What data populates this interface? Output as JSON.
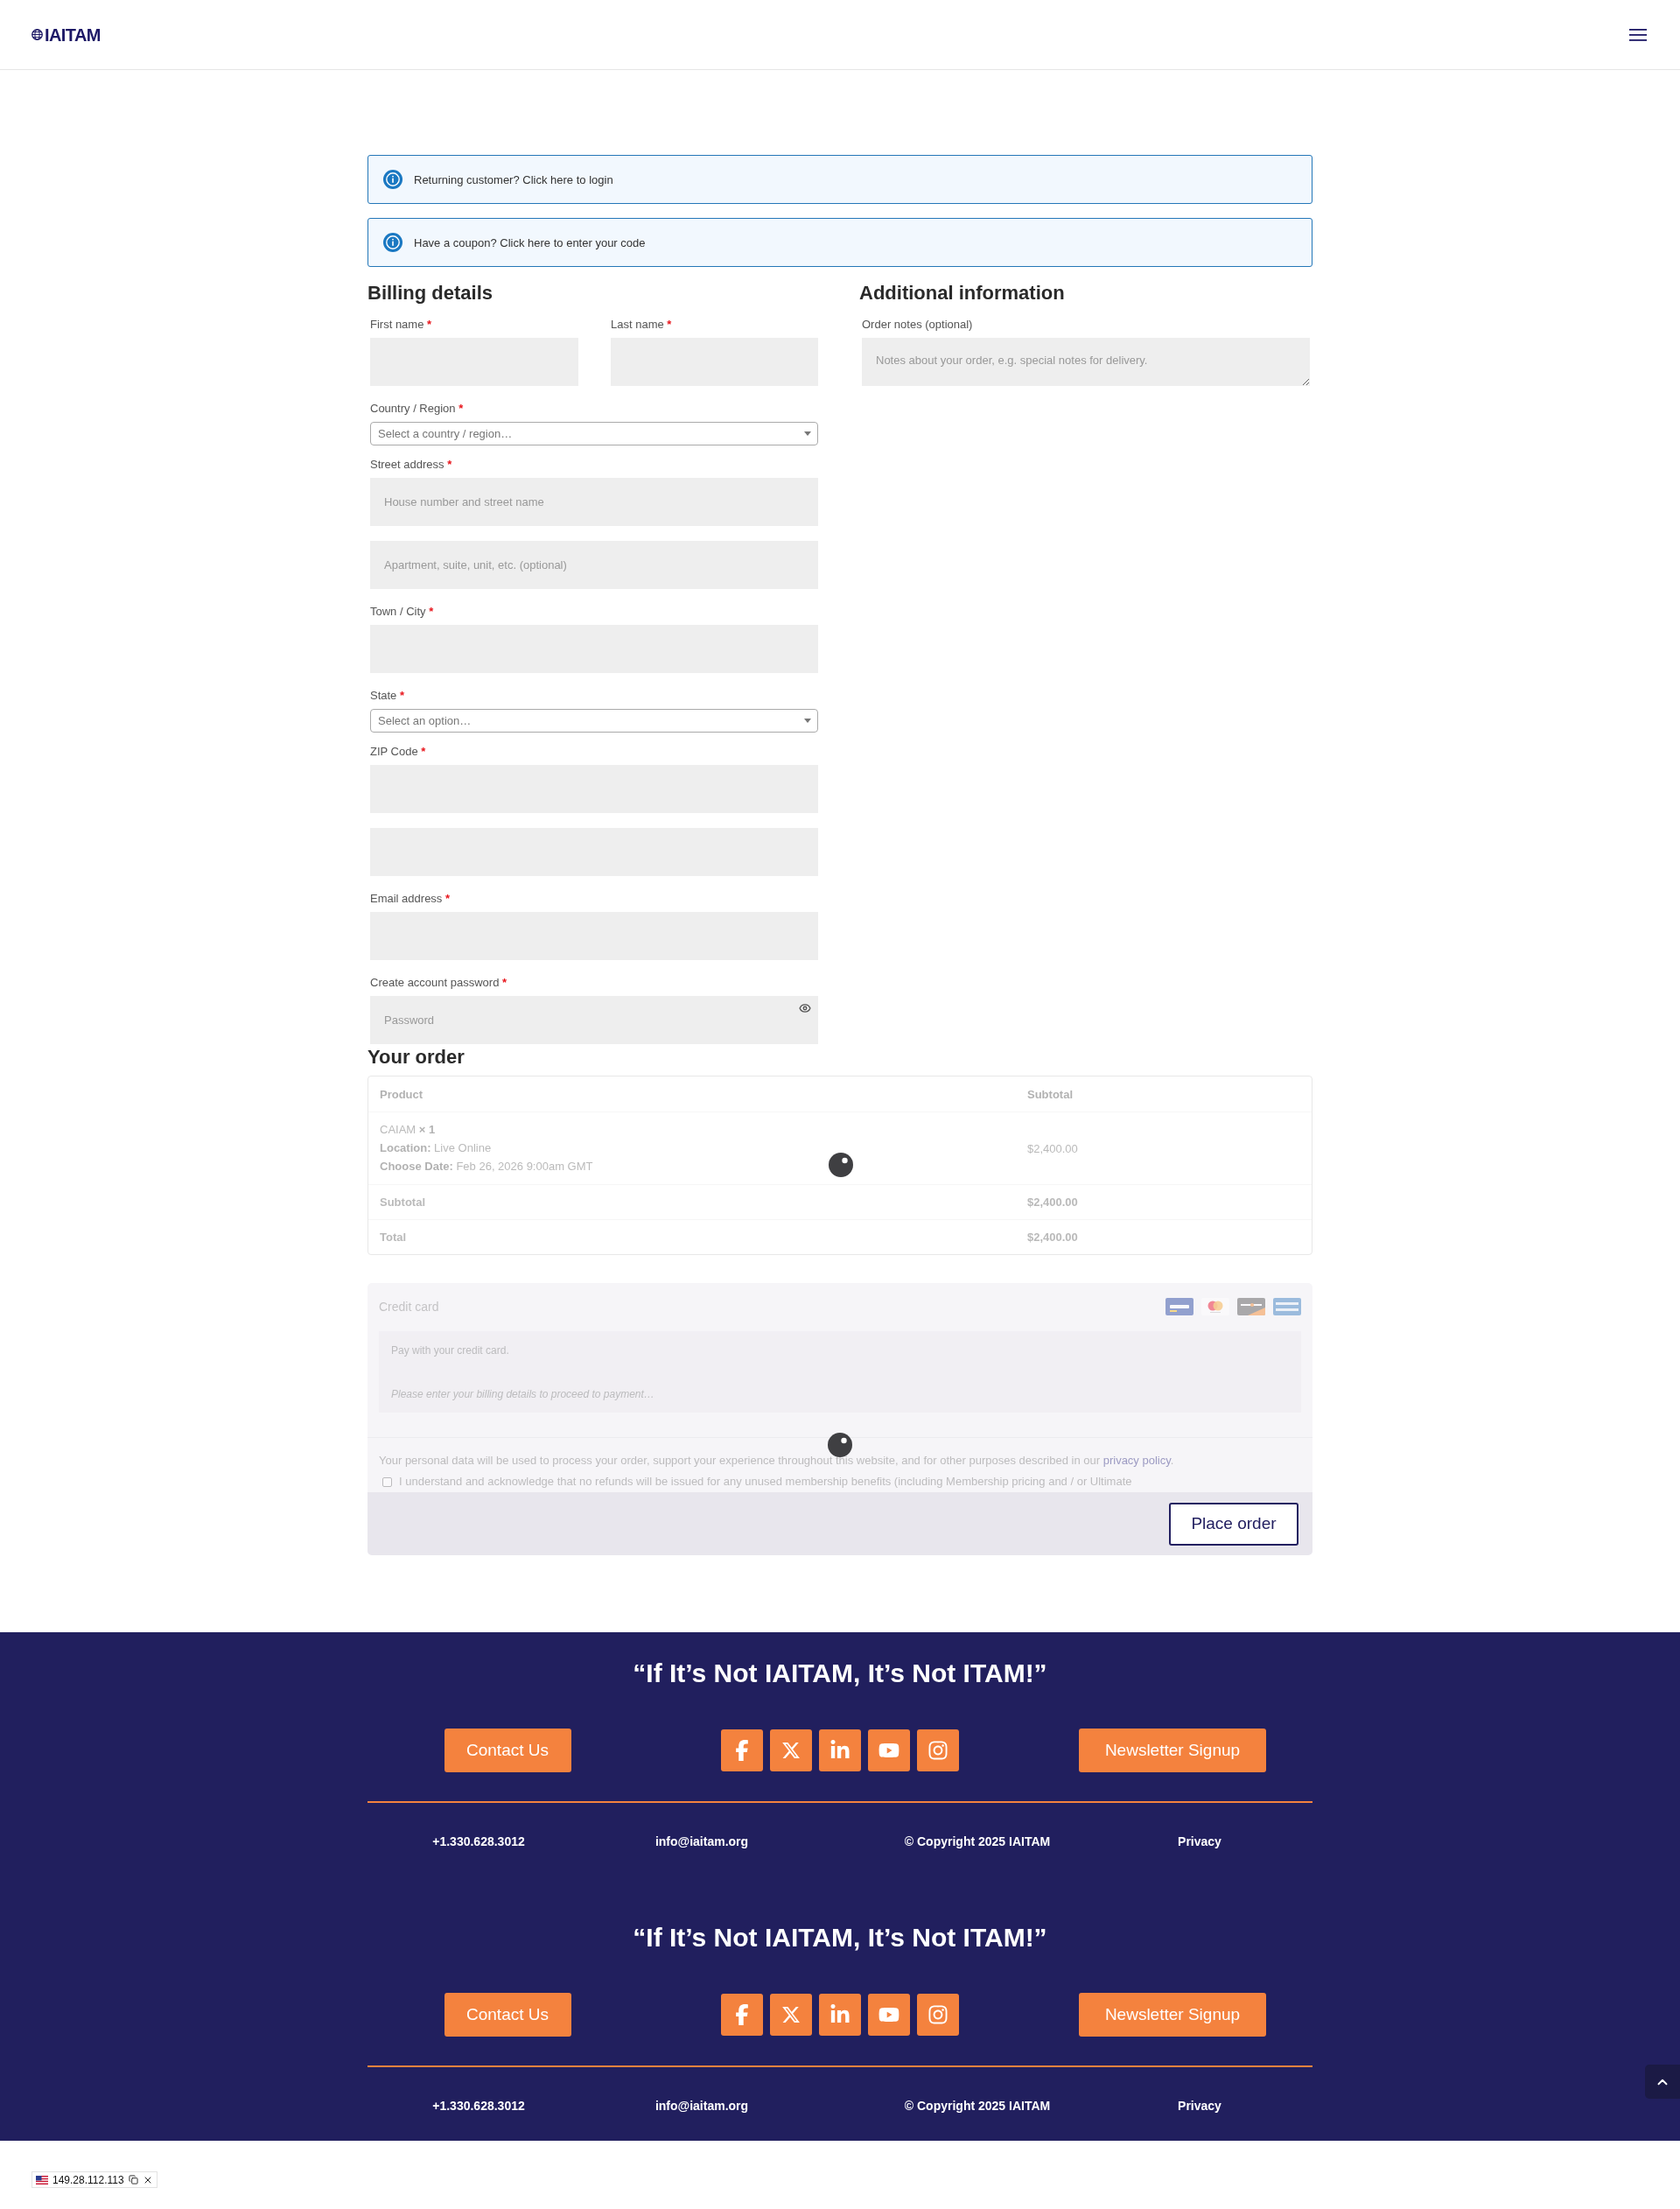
{
  "header": {
    "logo_text": "IAITAM"
  },
  "notices": [
    {
      "text": "Returning customer? Click here to login"
    },
    {
      "text": "Have a coupon? Click here to enter your code"
    }
  ],
  "billing": {
    "title": "Billing details",
    "rows": [
      [
        {
          "kind": "text",
          "label": "First name",
          "required_mark": "*"
        },
        {
          "kind": "text",
          "label": "Last name",
          "required_mark": "*"
        }
      ],
      [
        {
          "kind": "select",
          "label": "Country / Region",
          "required_mark": "*",
          "placeholder": "Select a country / region…"
        }
      ],
      [
        {
          "kind": "text",
          "label": "Street address",
          "required_mark": "*",
          "placeholder": "House number and street name"
        }
      ],
      [
        {
          "kind": "text",
          "placeholder": "Apartment, suite, unit, etc. (optional)"
        }
      ],
      [
        {
          "kind": "text",
          "label": "Town / City",
          "required_mark": "*"
        }
      ],
      [
        {
          "kind": "select",
          "label": "State",
          "required_mark": "*",
          "placeholder": "Select an option…"
        }
      ],
      [
        {
          "kind": "text",
          "label": "ZIP Code",
          "required_mark": "*"
        }
      ],
      [
        {
          "kind": "text"
        }
      ],
      [
        {
          "kind": "text",
          "label": "Email address",
          "required_mark": "*"
        }
      ],
      [
        {
          "kind": "password",
          "label": "Create account password",
          "required_mark": "*",
          "placeholder": "Password"
        }
      ]
    ]
  },
  "additional": {
    "title": "Additional information",
    "fields": [
      {
        "kind": "textarea",
        "label": "Order notes (optional)",
        "placeholder": "Notes about your order, e.g. special notes for delivery."
      }
    ]
  },
  "order": {
    "title": "Your order",
    "loading": true,
    "columns": [
      "Product",
      "Subtotal"
    ],
    "items": [
      {
        "name": "CAIAM **× 1**",
        "meta": [
          "**Location:** Live Online",
          "**Choose Date:** Feb 26, 2026 9:00am GMT"
        ],
        "subtotal": "$2,400.00"
      }
    ],
    "totals": [
      {
        "label": "Subtotal",
        "value": "$2,400.00"
      },
      {
        "label": "Total",
        "value": "$2,400.00"
      }
    ]
  },
  "payment": {
    "method": "Credit card",
    "description": "Pay with your credit card.",
    "notice": "Please enter your billing details to proceed to payment…",
    "privacy": {
      "before": "Your personal data will be used to process your order, support your experience throughout this website, and for other purposes described in our ",
      "link": "privacy policy",
      "after": "."
    },
    "terms": {
      "checked": false,
      "text": "I understand and acknowledge that no refunds will be issued for any unused membership benefits (including Membership pricing and / or Ultimate"
    },
    "button": "Place order"
  },
  "footer": {
    "blocks": [
      {
        "slogan": "“If It’s Not IAITAM, It’s Not ITAM!”",
        "contact_button": "Contact Us",
        "social": [
          {
            "kind": "facebook"
          },
          {
            "kind": "x"
          },
          {
            "kind": "linkedin"
          },
          {
            "kind": "youtube"
          },
          {
            "kind": "instagram"
          }
        ],
        "newsletter_button": "Newsletter Signup",
        "info": [
          "+1.330.628.3012",
          "info@iaitam.org",
          "© Copyright 2025 IAITAM",
          "Privacy"
        ]
      },
      {
        "slogan": "“If It’s Not IAITAM, It’s Not ITAM!”",
        "contact_button": "Contact Us",
        "social": [
          {
            "kind": "facebook"
          },
          {
            "kind": "x"
          },
          {
            "kind": "linkedin"
          },
          {
            "kind": "youtube"
          },
          {
            "kind": "instagram"
          }
        ],
        "newsletter_button": "Newsletter Signup",
        "info": [
          "+1.330.628.3012",
          "info@iaitam.org",
          "© Copyright 2025 IAITAM",
          "Privacy"
        ]
      }
    ]
  },
  "ip_badge": {
    "ip": "149.28.112.113"
  }
}
